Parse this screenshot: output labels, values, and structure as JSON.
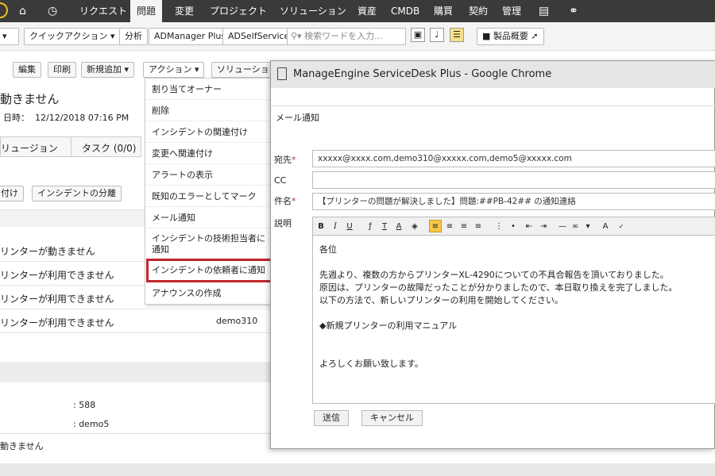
{
  "topnav": {
    "items": [
      "リクエスト",
      "問題",
      "変更",
      "プロジェクト",
      "ソリューション",
      "資産",
      "CMDB",
      "購買",
      "契約",
      "管理"
    ],
    "active": "問題"
  },
  "toolbar": {
    "quick_action": "クイックアクション",
    "analysis": "分析",
    "admanager": "ADManager Plus",
    "adselfservice": "ADSelfService",
    "search_placeholder": "検索ワードを入力...",
    "product_overview": "製品概要"
  },
  "actions": {
    "edit": "編集",
    "print": "印刷",
    "add_new": "新規追加",
    "action": "アクション",
    "solution": "ソリューション"
  },
  "problem": {
    "title_fragment": "動きません",
    "date_label": "日時：",
    "date_value": "12/12/2018 07:16 PM",
    "tab_solution": "リュージョン",
    "tab_task": "タスク (0/0)",
    "attach_btn": "付け",
    "classify_btn": "インシデントの分離",
    "rows": [
      {
        "text": "リンターが動きません",
        "owner": ""
      },
      {
        "text": "リンターが利用できません",
        "owner": ""
      },
      {
        "text": "リンターが利用できません",
        "owner": ""
      },
      {
        "text": "リンターが利用できません",
        "owner": "demo310"
      }
    ],
    "detail_588": ": 588",
    "detail_demo5": ": demo5",
    "footer_text": "動きません"
  },
  "dropdown": {
    "items": [
      "割り当てオーナー",
      "削除",
      "インシデントの関連付け",
      "変更へ関連付け",
      "アラートの表示",
      "既知のエラーとしてマーク",
      "メール通知",
      "インシデントの技術担当者に",
      "通知",
      "インシデントの依頼者に通知",
      "アナウンスの作成"
    ]
  },
  "dialog": {
    "window_title": "ManageEngine ServiceDesk Plus - Google Chrome",
    "section_title": "メール通知",
    "to_label": "宛先",
    "to_value": "xxxxx@xxxx.com,demo310@xxxxx.com,demo5@xxxxx.com",
    "cc_label": "CC",
    "cc_value": "",
    "subject_label": "件名",
    "subject_value": "【プリンターの問題が解決しました】問題:##PB-42## の通知連絡",
    "description_label": "説明",
    "body": [
      "各位",
      "",
      "先週より、複数の方からプリンターXL-4290についての不具合報告を頂いておりました。",
      "原因は、プリンターの故障だったことが分かりましたので、本日取り換えを完了しました。",
      "以下の方法で、新しいプリンターの利用を開始してください。",
      "",
      "◆新規プリンターの利用マニュアル",
      "",
      "",
      "よろしくお願い致します。"
    ],
    "send": "送信",
    "cancel": "キャンセル"
  },
  "colors": {
    "nav_bg": "#3a3a3a",
    "highlight": "#c0272d",
    "required": "#c0272d",
    "editor_active": "#f8c64a"
  }
}
